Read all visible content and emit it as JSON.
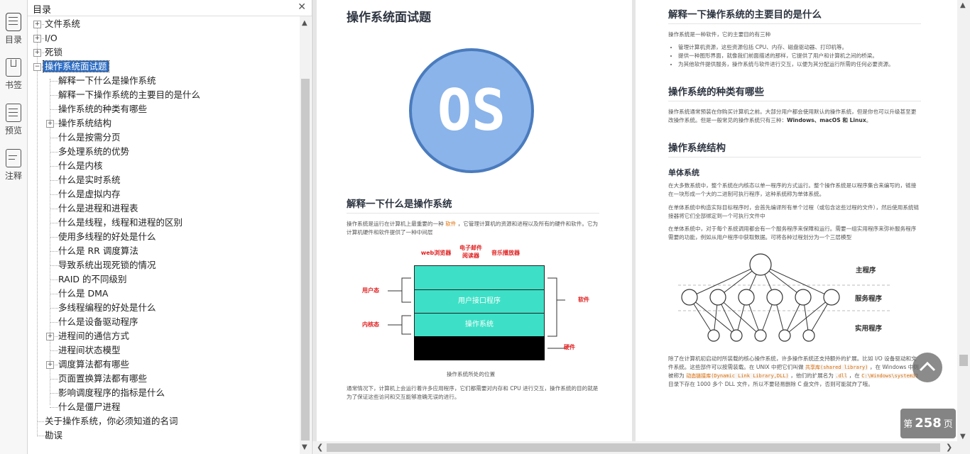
{
  "rail": [
    {
      "label": "目录",
      "icon": "list-icon"
    },
    {
      "label": "书签",
      "icon": "bookmark-icon"
    },
    {
      "label": "预览",
      "icon": "preview-icon"
    },
    {
      "label": "注释",
      "icon": "note-icon"
    }
  ],
  "toc": {
    "title": "目录",
    "items": [
      {
        "label": "文件系统",
        "level": 0,
        "toggle": "+"
      },
      {
        "label": "I/O",
        "level": 0,
        "toggle": "+"
      },
      {
        "label": "死锁",
        "level": 0,
        "toggle": "+"
      },
      {
        "label": "操作系统面试题",
        "level": 0,
        "toggle": "-",
        "selected": true
      },
      {
        "label": "解释一下什么是操作系统",
        "level": 1
      },
      {
        "label": "解释一下操作系统的主要目的是什么",
        "level": 1
      },
      {
        "label": "操作系统的种类有哪些",
        "level": 1
      },
      {
        "label": "操作系统结构",
        "level": 1,
        "toggle": "+"
      },
      {
        "label": "什么是按需分页",
        "level": 1
      },
      {
        "label": "多处理系统的优势",
        "level": 1
      },
      {
        "label": "什么是内核",
        "level": 1
      },
      {
        "label": "什么是实时系统",
        "level": 1
      },
      {
        "label": "什么是虚拟内存",
        "level": 1
      },
      {
        "label": "什么是进程和进程表",
        "level": 1
      },
      {
        "label": "什么是线程，线程和进程的区别",
        "level": 1
      },
      {
        "label": "使用多线程的好处是什么",
        "level": 1
      },
      {
        "label": "什么是 RR 调度算法",
        "level": 1
      },
      {
        "label": "导致系统出现死锁的情况",
        "level": 1
      },
      {
        "label": "RAID 的不同级别",
        "level": 1
      },
      {
        "label": "什么是 DMA",
        "level": 1
      },
      {
        "label": "多线程编程的好处是什么",
        "level": 1
      },
      {
        "label": "什么是设备驱动程序",
        "level": 1
      },
      {
        "label": "进程间的通信方式",
        "level": 1,
        "toggle": "+"
      },
      {
        "label": "进程间状态模型",
        "level": 1
      },
      {
        "label": "调度算法都有哪些",
        "level": 1,
        "toggle": "+"
      },
      {
        "label": "页面置换算法都有哪些",
        "level": 1
      },
      {
        "label": "影响调度程序的指标是什么",
        "level": 1
      },
      {
        "label": "什么是僵尸进程",
        "level": 1
      },
      {
        "label": "关于操作系统，你必须知道的名词",
        "level": 0
      },
      {
        "label": "勘误",
        "level": 0
      }
    ]
  },
  "left_page": {
    "title": "操作系统面试题",
    "logo_text": "OS",
    "h2": "解释一下什么是操作系统",
    "p1_a": "操作系统是运行在计算机上最重要的一种",
    "p1_hl": "软件",
    "p1_b": "，它管理计算机的资源和进程以及所有的硬件和软件。它为计算机硬件和软件提供了一种中间层",
    "fig": {
      "apps": [
        "web浏览器",
        "电子邮件\n阅读器",
        "音乐播放器"
      ],
      "layer_ui": "用户接口程序",
      "layer_os": "操作系统",
      "left_user": "用户态",
      "left_kernel": "内核态",
      "right_soft": "软件",
      "right_hard": "硬件",
      "caption": "操作系统所处的位置"
    },
    "p2": "通常情况下，计算机上会运行着许多应用程序，它们都需要对内存和 CPU 进行交互，操作系统的目的就是为了保证这些访问和交互能够准确无误的进行。"
  },
  "right_page": {
    "h2a": "解释一下操作系统的主要目的是什么",
    "pa": "操作系统是一种软件，它的主要目的有三种",
    "bullets": [
      "管理计算机资源，这些资源包括 CPU、内存、磁盘驱动器、打印机等。",
      "提供一种图形界面，就像我们前面描述的那样，它提供了用户和计算机之间的桥梁。",
      "为其他软件提供服务，操作系统与软件进行交互，以便为其分配运行所需的任何必要资源。"
    ],
    "h2b": "操作系统的种类有哪些",
    "pb_a": "操作系统通常预装在你购买计算机之前。大部分用户都会使用默认的操作系统，但是你也可以升级甚至更改操作系统。但是一般常见的操作系统只有三种：",
    "pb_b": "Windows、macOS 和 Linux",
    "pb_c": "。",
    "h2c": "操作系统结构",
    "h3": "单体系统",
    "pc1": "在大多数系统中，整个系统在内核态以单一程序的方式运行。整个操作系统是以程序集合来编写的，链接在一块形成一个大的二进制可执行程序，这种系统称为单体系统。",
    "pc2": "在单体系统中构造实际目标程序时，会首先编译所有单个过程（或包含这些过程的文件），然后使用系统链接器将它们全部绑定到一个可执行文件中",
    "pc3": "在单体系统中，对于每个系统调用都会有一个服务程序来保障和运行。需要一组实用程序来弥补服务程序需要的功能，例如从用户程序中获取数据。可将各种过程划分为一个三层模型",
    "tree_labels": [
      "主程序",
      "服务程序",
      "实用程序"
    ],
    "pd_a": "除了在计算机初启动时所装载的核心操作系统，许多操作系统还支持额外的扩展。比如 I/O 设备驱动和文件系统。这些部件可以按需装载。在 UNIX 中把它们叫做",
    "pd_code1": "共享库(shared library)",
    "pd_b": "，在 Windows 中则被称为",
    "pd_code2": "动态链接库(Dynamic Link Library,DLL)",
    "pd_c": "，他们的扩展名为",
    "pd_code3": ".dll",
    "pd_d": "，在",
    "pd_code4": "C:\\Windows\\system32",
    "pd_e": "目录下存在 1000 多个 DLL 文件，所以不要轻易删除 C 盘文件，否则可能就炸了哦。"
  },
  "page_badge": {
    "prefix": "第",
    "num": "258",
    "suffix": "页"
  },
  "colors": {
    "selection": "#2b6cc4",
    "os_circle": "#8ab4ea",
    "os_ring": "#4a7bbd",
    "teal": "#3de0c6",
    "app_blue": "#2e8ae6",
    "red_label": "#e02020"
  }
}
